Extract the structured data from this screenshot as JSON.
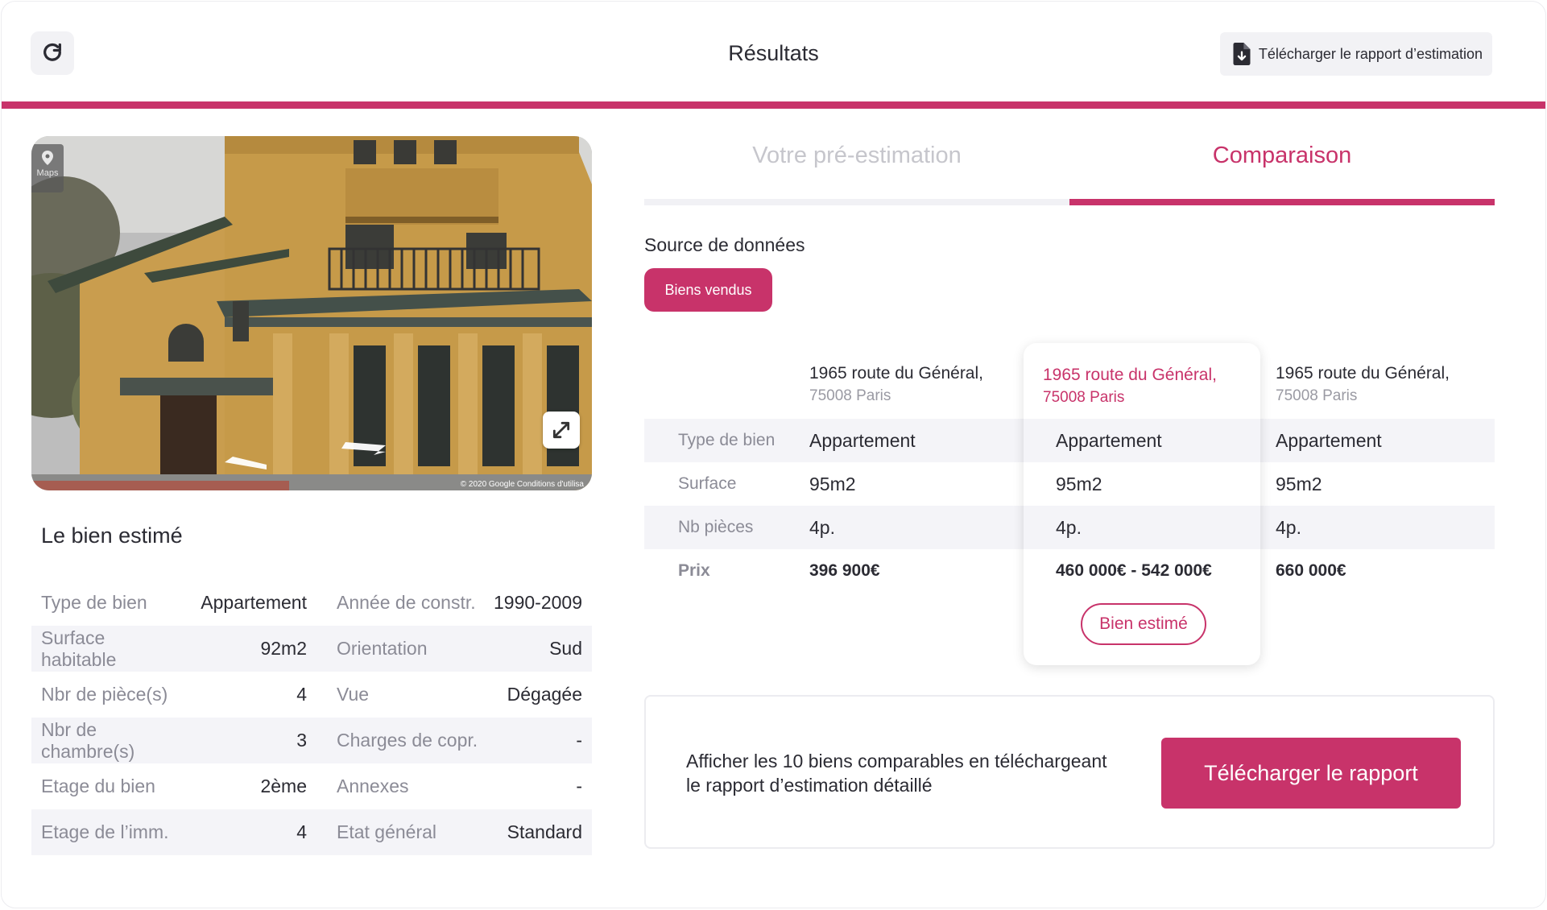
{
  "header": {
    "title": "Résultats",
    "download_label": "Télécharger le rapport d’estimation"
  },
  "photo": {
    "maps_label": "Maps",
    "copyright": "© 2020 Google   Conditions d'utilisa"
  },
  "property": {
    "title": "Le bien estimé",
    "rows": [
      {
        "label1": "Type de bien",
        "value1": "Appartement",
        "label2": "Année de constr.",
        "value2": "1990-2009"
      },
      {
        "label1": "Surface habitable",
        "value1": "92m2",
        "label2": "Orientation",
        "value2": "Sud"
      },
      {
        "label1": "Nbr de pièce(s)",
        "value1": "4",
        "label2": "Vue",
        "value2": "Dégagée"
      },
      {
        "label1": "Nbr de chambre(s)",
        "value1": "3",
        "label2": "Charges de copr.",
        "value2": "-"
      },
      {
        "label1": "Etage du bien",
        "value1": "2ème",
        "label2": "Annexes",
        "value2": "-"
      },
      {
        "label1": "Etage de l’imm.",
        "value1": "4",
        "label2": "Etat général",
        "value2": "Standard"
      }
    ]
  },
  "tabs": {
    "pre_estimation": "Votre pré-estimation",
    "comparaison": "Comparaison"
  },
  "source": {
    "label": "Source de données",
    "button": "Biens vendus"
  },
  "comparison": {
    "columns": [
      {
        "line1": "1965 route du Général,",
        "line2": "75008 Paris"
      },
      {
        "line1": "1965 route du Général,",
        "line2": "75008 Paris"
      },
      {
        "line1": "1965 route du Général,",
        "line2": "75008 Paris"
      }
    ],
    "rows": [
      {
        "label": "Type de bien",
        "values": [
          "Appartement",
          "Appartement",
          "Appartement"
        ]
      },
      {
        "label": "Surface",
        "values": [
          "95m2",
          "95m2",
          "95m2"
        ]
      },
      {
        "label": "Nb pièces",
        "values": [
          "4p.",
          "4p.",
          "4p."
        ]
      },
      {
        "label": "Prix",
        "values": [
          "396 900€",
          "460 000€ - 542 000€",
          "660 000€"
        ]
      }
    ],
    "estimated_badge": "Bien estimé"
  },
  "cta": {
    "text_line1": "Afficher les 10 biens comparables en téléchargeant",
    "text_line2": "le rapport d’estimation détaillé",
    "button": "Télécharger le rapport"
  },
  "colors": {
    "accent": "#c8336a",
    "muted": "#8b8b96",
    "row_shade": "#f4f4f8"
  }
}
